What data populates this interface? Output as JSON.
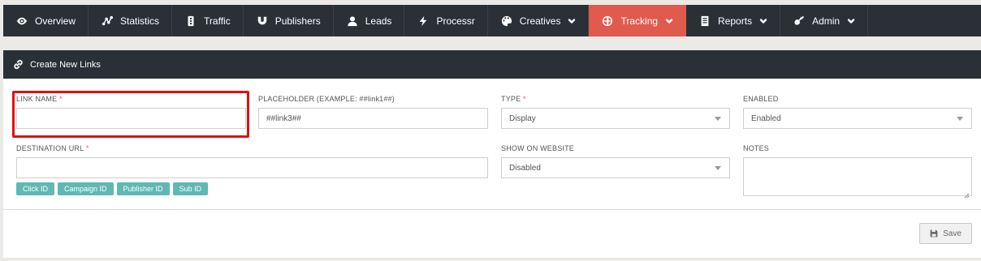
{
  "nav": {
    "items": [
      {
        "label": "Overview",
        "icon": "eye-icon",
        "caret": false,
        "active": false
      },
      {
        "label": "Statistics",
        "icon": "chart-icon",
        "caret": false,
        "active": false
      },
      {
        "label": "Traffic",
        "icon": "traffic-light-icon",
        "caret": false,
        "active": false
      },
      {
        "label": "Publishers",
        "icon": "magnet-icon",
        "caret": false,
        "active": false
      },
      {
        "label": "Leads",
        "icon": "user-icon",
        "caret": false,
        "active": false
      },
      {
        "label": "Processr",
        "icon": "bolt-icon",
        "caret": false,
        "active": false
      },
      {
        "label": "Creatives",
        "icon": "palette-icon",
        "caret": true,
        "active": false
      },
      {
        "label": "Tracking",
        "icon": "crosshair-icon",
        "caret": true,
        "active": true
      },
      {
        "label": "Reports",
        "icon": "report-icon",
        "caret": true,
        "active": false
      },
      {
        "label": "Admin",
        "icon": "guitar-icon",
        "caret": true,
        "active": false
      }
    ]
  },
  "panel": {
    "title": "Create New Links"
  },
  "form": {
    "link_name": {
      "label": "LINK NAME",
      "required": "*",
      "value": ""
    },
    "placeholder": {
      "label": "PLACEHOLDER (EXAMPLE: ##link1##)",
      "value": "##link3##"
    },
    "type": {
      "label": "TYPE",
      "required": "*",
      "value": "Display"
    },
    "enabled": {
      "label": "ENABLED",
      "value": "Enabled"
    },
    "destination_url": {
      "label": "DESTINATION URL",
      "required": "*",
      "value": ""
    },
    "show_on_website": {
      "label": "SHOW ON WEBSITE",
      "value": "Disabled"
    },
    "notes": {
      "label": "NOTES",
      "value": ""
    }
  },
  "chips": [
    "Click ID",
    "Campaign ID",
    "Publisher ID",
    "Sub ID"
  ],
  "save_label": "Save",
  "colors": {
    "nav_bg": "#2b3036",
    "active": "#e05a4e",
    "chip": "#5fb8b4",
    "highlight": "#e01010"
  }
}
